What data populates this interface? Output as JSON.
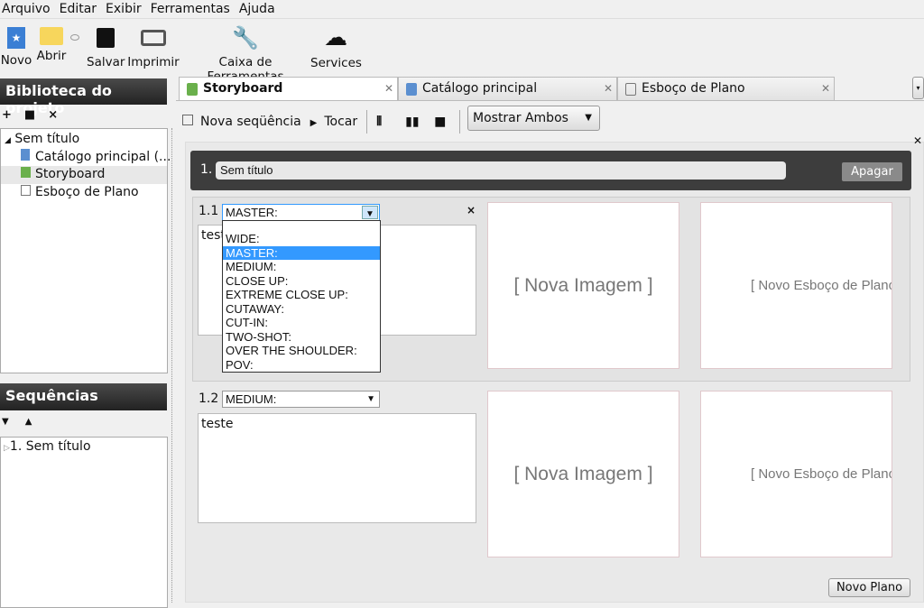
{
  "menu": [
    "Arquivo",
    "Editar",
    "Exibir",
    "Ferramentas",
    "Ajuda"
  ],
  "toolbar": {
    "novo": "Novo",
    "abrir": "Abrir",
    "salvar": "Salvar",
    "imprimir": "Imprimir",
    "caixa": "Caixa de Ferramentas",
    "services": "Services"
  },
  "library": {
    "title": "Biblioteca do projeto",
    "root": "Sem título",
    "items": [
      "Catálogo principal (...",
      "Storyboard",
      "Esboço de Plano"
    ]
  },
  "sequences": {
    "title": "Sequências",
    "items": [
      "1. Sem título"
    ]
  },
  "tabs": [
    {
      "label": "Storyboard",
      "active": true
    },
    {
      "label": "Catálogo principal"
    },
    {
      "label": "Esboço de Plano"
    }
  ],
  "storyboard_toolbar": {
    "nova_sequencia": "Nova seqüência",
    "tocar": "Tocar",
    "view_select": "Mostrar Ambos"
  },
  "sequence": {
    "number": "1.",
    "title": "Sem título",
    "delete": "Apagar"
  },
  "shots": [
    {
      "number": "1.1",
      "type": "MASTER:",
      "text": "teste",
      "image": "[ Nova Imagem ]",
      "sketch": "[ Novo Esboço de Plano ]"
    },
    {
      "number": "1.2",
      "type": "MEDIUM:",
      "text": "teste",
      "image": "[ Nova Imagem ]",
      "sketch": "[ Novo Esboço de Plano ]"
    }
  ],
  "shot_type_options": [
    "WIDE:",
    "MASTER:",
    "MEDIUM:",
    "CLOSE UP:",
    "EXTREME CLOSE UP:",
    "CUTAWAY:",
    "CUT-IN:",
    "TWO-SHOT:",
    "OVER THE SHOULDER:",
    "POV:"
  ],
  "selected_option": "MASTER:",
  "new_shot": "Novo Plano",
  "colors": {
    "header_dark": "#2b2b2b",
    "selection": "#3399ff"
  }
}
